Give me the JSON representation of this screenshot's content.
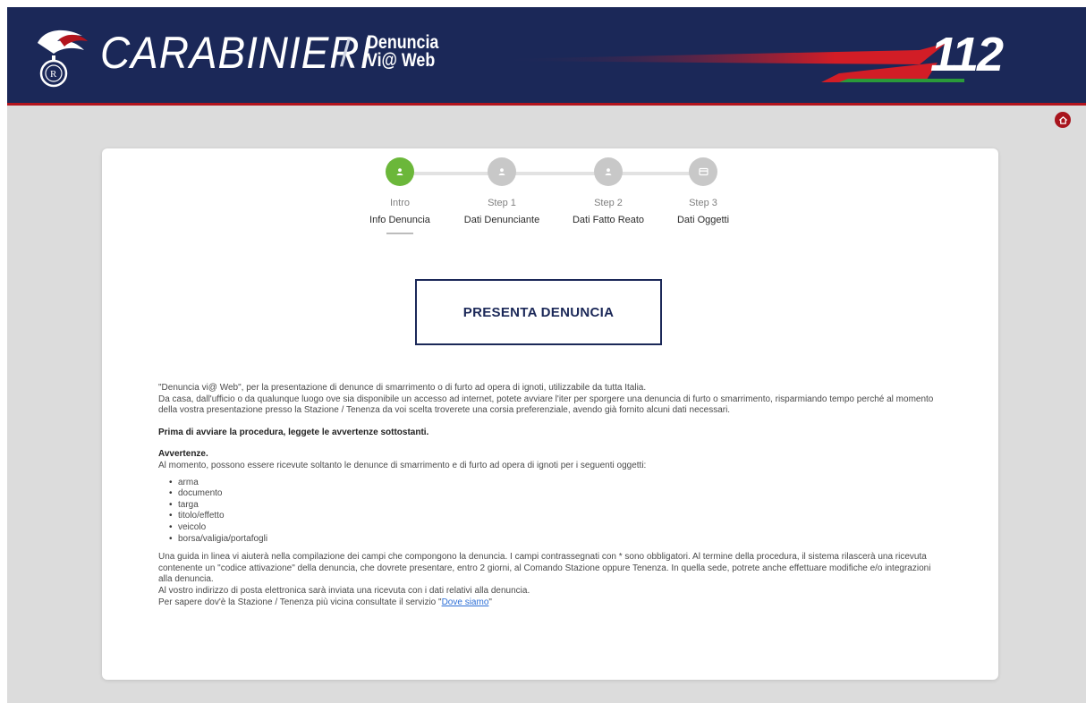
{
  "header": {
    "brand": "CARABINIERI",
    "separator": "/",
    "subtitle_line1": "Denuncia",
    "subtitle_line2": "Vi@ Web",
    "emergency_number": "112"
  },
  "steps": [
    {
      "label": "Intro",
      "sub": "Info Denuncia",
      "active": true,
      "icon": "user-icon"
    },
    {
      "label": "Step 1",
      "sub": "Dati Denunciante",
      "active": false,
      "icon": "user-icon"
    },
    {
      "label": "Step 2",
      "sub": "Dati Fatto Reato",
      "active": false,
      "icon": "user-icon"
    },
    {
      "label": "Step 3",
      "sub": "Dati Oggetti",
      "active": false,
      "icon": "card-icon"
    }
  ],
  "cta": {
    "label": "PRESENTA DENUNCIA"
  },
  "intro": {
    "p1": "\"Denuncia vi@ Web\", per la presentazione di denunce di smarrimento o di furto ad opera di ignoti, utilizzabile da tutta Italia.",
    "p2": "Da casa, dall'ufficio o da qualunque luogo ove sia disponibile un accesso ad internet, potete avviare l'iter per sporgere una denuncia di furto o smarrimento, risparmiando tempo perché al momento della vostra presentazione presso la Stazione / Tenenza da voi scelta troverete una corsia preferenziale, avendo già fornito alcuni dati necessari.",
    "warning": "Prima di avviare la procedura, leggete le avvertenze sottostanti.",
    "avvertenze_title": "Avvertenze.",
    "avvertenze_text": "Al momento, possono essere ricevute soltanto le denunce di smarrimento e di furto ad opera di ignoti per i seguenti oggetti:",
    "items": [
      "arma",
      "documento",
      "targa",
      "titolo/effetto",
      "veicolo",
      "borsa/valigia/portafogli"
    ],
    "guide": "Una guida in linea vi aiuterà nella compilazione dei campi che compongono la denuncia. I campi contrassegnati con * sono obbligatori. Al termine della procedura, il sistema rilascerà una ricevuta contenente un \"codice attivazione\" della denuncia, che dovrete presentare, entro 2 giorni, al Comando Stazione oppure Tenenza. In quella sede, potrete anche effettuare modifiche e/o integrazioni alla denuncia.",
    "email": "Al vostro indirizzo di posta elettronica sarà inviata una ricevuta con i dati relativi alla denuncia.",
    "dove_prefix": "Per sapere dov'è la Stazione / Tenenza più vicina consultate il servizio ",
    "dove_quote_open": "\"",
    "dove_link": "Dove siamo",
    "dove_quote_close": "\""
  },
  "colors": {
    "navy": "#1b2858",
    "red": "#b3141d",
    "green": "#6bb73a",
    "grey_step": "#c8c8c8"
  }
}
